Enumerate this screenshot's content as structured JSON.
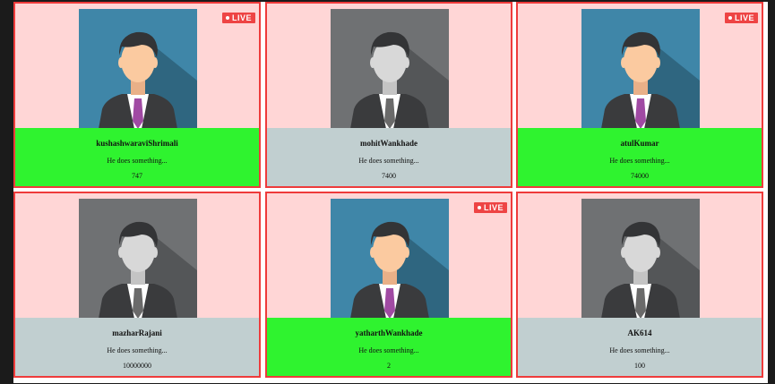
{
  "live_label": "LIVE",
  "colors": {
    "card_bg": "#ffd6d6",
    "card_border": "#ee3b3b",
    "info_online": "#2ff32f",
    "info_offline": "#c1cfd0",
    "live_badge": "#ee4444"
  },
  "profiles": [
    {
      "name": "kushashwaraviShrimali",
      "description": "He does something...",
      "count": "747",
      "live": true,
      "avatar": "colored-avatar-icon"
    },
    {
      "name": "mohitWankhade",
      "description": "He does something...",
      "count": "7400",
      "live": false,
      "avatar": "gray-avatar-icon"
    },
    {
      "name": "atulKumar",
      "description": "He does something...",
      "count": "74000",
      "live": true,
      "avatar": "colored-avatar-icon"
    },
    {
      "name": "mazharRajani",
      "description": "He does something...",
      "count": "10000000",
      "live": false,
      "avatar": "gray-avatar-icon"
    },
    {
      "name": "yatharthWankhade",
      "description": "He does something...",
      "count": "2",
      "live": true,
      "avatar": "colored-avatar-icon"
    },
    {
      "name": "AK614",
      "description": "He does something...",
      "count": "100",
      "live": false,
      "avatar": "gray-avatar-icon"
    }
  ]
}
